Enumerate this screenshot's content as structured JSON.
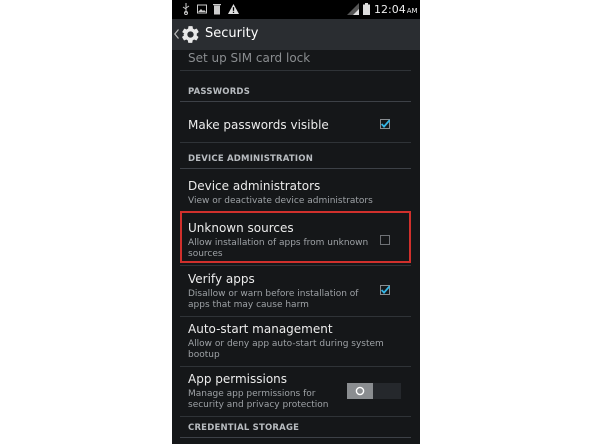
{
  "status_bar": {
    "time": "12:04",
    "ampm": "AM"
  },
  "action_bar": {
    "title": "Security"
  },
  "items": {
    "sim_lock": {
      "title": "Set up SIM card lock"
    },
    "make_passwords": {
      "title": "Make passwords visible",
      "checked": true
    },
    "device_admins": {
      "title": "Device administrators",
      "subtitle": "View or deactivate device administrators"
    },
    "unknown_sources": {
      "title": "Unknown sources",
      "subtitle_line1": "Allow installation of apps from unknown",
      "subtitle_line2": "sources",
      "checked": false
    },
    "verify_apps": {
      "title": "Verify apps",
      "subtitle_line1": "Disallow or warn before installation of",
      "subtitle_line2": "apps that may cause harm",
      "checked": true
    },
    "auto_start": {
      "title": "Auto-start management",
      "subtitle_line1": "Allow or deny app auto-start during system",
      "subtitle_line2": "bootup"
    },
    "app_permissions": {
      "title": "App permissions",
      "subtitle_line1": "Manage app permissions for",
      "subtitle_line2": "security and privacy protection",
      "toggle_on": true
    }
  },
  "headers": {
    "passwords": "PASSWORDS",
    "device_administration": "DEVICE ADMINISTRATION",
    "credential_storage": "CREDENTIAL STORAGE"
  },
  "colors": {
    "background": "#151719",
    "accent_check": "#33b5e5",
    "highlight_border": "#d0302c"
  },
  "icons": [
    "usb-icon",
    "image-icon",
    "trash-icon",
    "warning-icon",
    "signal-icon",
    "battery-icon",
    "settings-gear-icon",
    "back-chevron-icon"
  ]
}
